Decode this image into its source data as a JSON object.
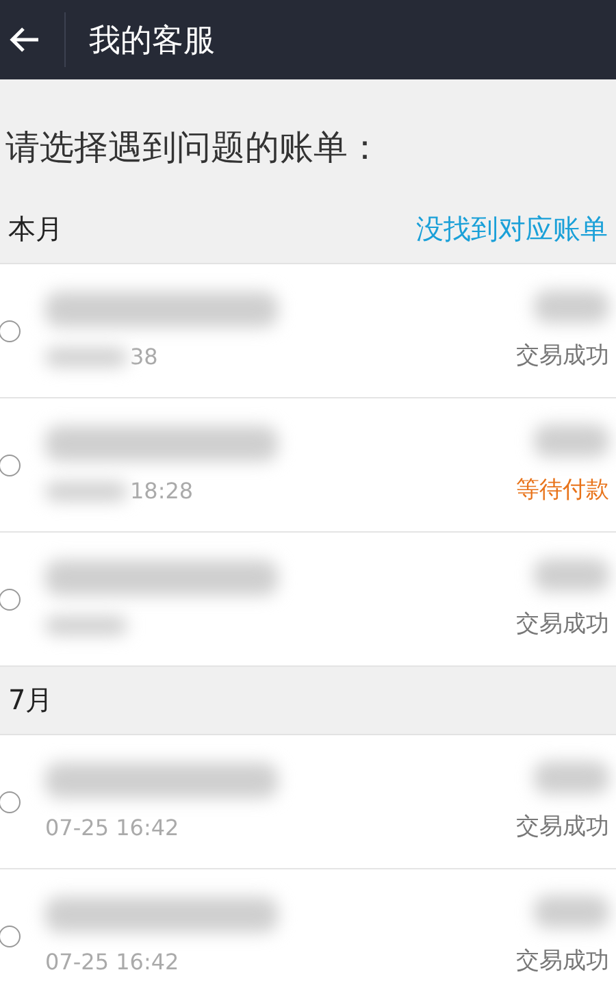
{
  "app_bar": {
    "title": "我的客服"
  },
  "prompt": "请选择遇到问题的账单：",
  "sections": [
    {
      "title": "本月",
      "link": "没找到对应账单",
      "bills": [
        {
          "selected": false,
          "time": "38",
          "status": "交易成功",
          "kind": "success"
        },
        {
          "selected": false,
          "time": "18:28",
          "status": "等待付款",
          "kind": "pending"
        },
        {
          "selected": false,
          "status": "交易成功",
          "kind": "success"
        }
      ]
    },
    {
      "title": "7月",
      "bills": [
        {
          "selected": false,
          "time": "07-25 16:42",
          "status": "交易成功",
          "kind": "success"
        },
        {
          "selected": false,
          "time": "07-25 16:42",
          "status": "交易成功",
          "kind": "success"
        }
      ]
    }
  ]
}
